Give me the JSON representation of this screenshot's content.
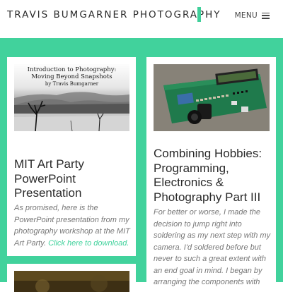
{
  "header": {
    "site_title": "TRAVIS BUMGARNER PHOTOGRAPHY",
    "menu_label": "MENU"
  },
  "colors": {
    "accent": "#41d29c",
    "card_bg": "#ffffff",
    "title_text": "#2a2a2a",
    "excerpt_text": "#777777"
  },
  "posts": [
    {
      "thumb_title_line1": "Introduction to Photography:",
      "thumb_title_line2": "Moving Beyond Snapshots",
      "thumb_author": "by Travis Bumgarner",
      "title": "MIT Art Party PowerPoint Presentation",
      "excerpt": "As promised, here is the PowerPoint presentation from my photography workshop at the MIT Art Party.",
      "link_text": "Click here to download."
    },
    {
      "title": "Combining Hobbies: Programming, Electronics & Photography Part III",
      "excerpt": "For better or worse, I made the decision to jump right into soldering as my next step with my camera. I'd soldered before but never to such a great extent with an end goal in mind. I began by arranging the components with ease of"
    }
  ]
}
